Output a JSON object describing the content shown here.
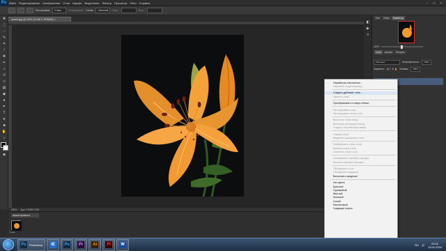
{
  "app": {
    "logo": "Ps",
    "menu": [
      "Файл",
      "Редактирование",
      "Изображение",
      "Слои",
      "Шрифт",
      "Выделение",
      "Фильтр",
      "Просмотр",
      "Окно",
      "Справка"
    ],
    "window_controls": [
      "–",
      "□",
      "×"
    ]
  },
  "options_bar": {
    "feather_label": "Растушевка:",
    "feather_value": "0 пикс.",
    "antialias_label": "Сглаживание",
    "style_label": "Стиль:",
    "style_value": "Обычный",
    "width_label": "Шир.:",
    "height_label": "Выс.:"
  },
  "document": {
    "tab_title": "лилия.jpg @ 100% (Слой 0, RGB/8#) ×",
    "zoom": "100%",
    "doc_info": "Док: 1,07М/1,07М"
  },
  "bottom_panel": {
    "tab": "Шкала времени",
    "thumb_label": "0 сек"
  },
  "right_panels": {
    "top_tabs": [
      "Гист",
      "Инфо",
      "Навигатор"
    ],
    "zoom_value": "100%",
    "layers_tabs": [
      "Слои",
      "Каналы",
      "Контуры"
    ],
    "blend_mode": "Обычные",
    "opacity_label": "Непрозрачность:",
    "opacity_value": "100%",
    "lock_label": "Закрепить:",
    "fill_label": "Заливка:",
    "fill_value": "100%"
  },
  "context_menu": {
    "items": [
      {
        "label": "Параметры наложения...",
        "state": "normal"
      },
      {
        "label": "Изменить корректировку...",
        "state": "disabled"
      },
      {
        "sep": true
      },
      {
        "label": "Создать дубликат слоя...",
        "state": "hover"
      },
      {
        "label": "Удалить слой",
        "state": "disabled"
      },
      {
        "sep": true
      },
      {
        "label": "Преобразовать в смарт-объект",
        "state": "normal"
      },
      {
        "sep": true
      },
      {
        "label": "Растрировать слой",
        "state": "disabled"
      },
      {
        "label": "Растрировать стиль слоя",
        "state": "disabled"
      },
      {
        "sep": true
      },
      {
        "label": "Включить слой-маску",
        "state": "disabled"
      },
      {
        "label": "Включить векторную маску",
        "state": "disabled"
      },
      {
        "label": "Создать обтравочную маску",
        "state": "disabled"
      },
      {
        "sep": true
      },
      {
        "label": "Связать слои",
        "state": "disabled"
      },
      {
        "label": "Выделить связанные слои",
        "state": "disabled"
      },
      {
        "sep": true
      },
      {
        "label": "Скопировать стиль слоя",
        "state": "disabled"
      },
      {
        "label": "Вклеить стиль слоя",
        "state": "disabled"
      },
      {
        "label": "Очистить стиль слоя",
        "state": "disabled"
      },
      {
        "sep": true
      },
      {
        "label": "Скопировать атрибуты фигуры",
        "state": "disabled"
      },
      {
        "label": "Вклеить атрибуты фигуры",
        "state": "disabled"
      },
      {
        "sep": true
      },
      {
        "label": "Объединить слои",
        "state": "disabled"
      },
      {
        "label": "Объединить видимые",
        "state": "disabled"
      },
      {
        "label": "Выполнить сведение",
        "state": "normal"
      },
      {
        "sep": true
      },
      {
        "label": "Нет цвета",
        "state": "normal"
      },
      {
        "label": "Красный",
        "state": "normal"
      },
      {
        "label": "Оранжевый",
        "state": "normal"
      },
      {
        "label": "Желтый",
        "state": "normal"
      },
      {
        "label": "Зеленый",
        "state": "normal"
      },
      {
        "label": "Синий",
        "state": "normal"
      },
      {
        "label": "Фиолетовый",
        "state": "normal"
      },
      {
        "label": "Градации серого",
        "state": "normal"
      }
    ]
  },
  "taskbar": {
    "active_app_label": "Photoshop",
    "apps": [
      "IE",
      "Ps",
      "Pr",
      "Ai",
      "Fl",
      "W"
    ],
    "language": "RU",
    "time": "23:41",
    "date": "13.01.2016"
  },
  "colors": {
    "accent_selection": "#485d7c",
    "menu_hover": "#dbe6f4",
    "petal": "#f29a2e",
    "leaf": "#3e6b2a"
  }
}
